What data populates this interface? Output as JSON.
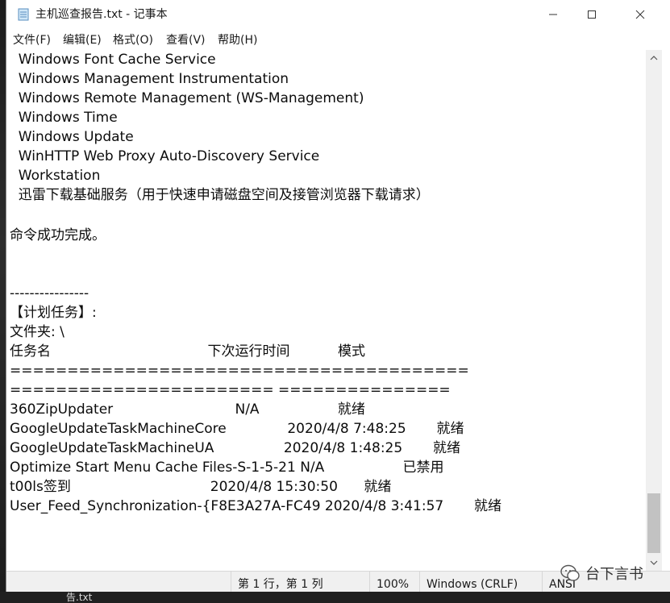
{
  "window": {
    "title": "主机巡查报告.txt - 记事本"
  },
  "menu": [
    {
      "label": "文件(F)"
    },
    {
      "label": "编辑(E)"
    },
    {
      "label": "格式(O)"
    },
    {
      "label": "查看(V)"
    },
    {
      "label": "帮助(H)"
    }
  ],
  "editor": {
    "lines": [
      "  Windows Font Cache Service",
      "  Windows Management Instrumentation",
      "  Windows Remote Management (WS-Management)",
      "  Windows Time",
      "  Windows Update",
      "  WinHTTP Web Proxy Auto-Discovery Service",
      "  Workstation",
      "  迅雷下载基础服务（用于快速申请磁盘空间及接管浏览器下载请求）",
      "",
      "命令成功完成。",
      "",
      "",
      "----------------",
      "【计划任务】:",
      "文件夹: \\",
      "任务名                                    下次运行时间           模式",
      "========================================",
      "======================= ===============",
      "360ZipUpdater                            N/A                  就绪",
      "GoogleUpdateTaskMachineCore              2020/4/8 7:48:25       就绪",
      "GoogleUpdateTaskMachineUA                2020/4/8 1:48:25       就绪",
      "Optimize Start Menu Cache Files-S-1-5-21 N/A                  已禁用",
      "t00ls签到                                2020/4/8 15:30:50      就绪",
      "User_Feed_Synchronization-{F8E3A27A-FC49 2020/4/8 3:41:57       就绪"
    ]
  },
  "status": {
    "position": "第 1 行，第 1 列",
    "zoom": "100%",
    "line_ending": "Windows (CRLF)",
    "encoding": "ANSI"
  },
  "watermark": {
    "text": "台下言书"
  },
  "taskbar": {
    "fragment": "告.txt"
  }
}
